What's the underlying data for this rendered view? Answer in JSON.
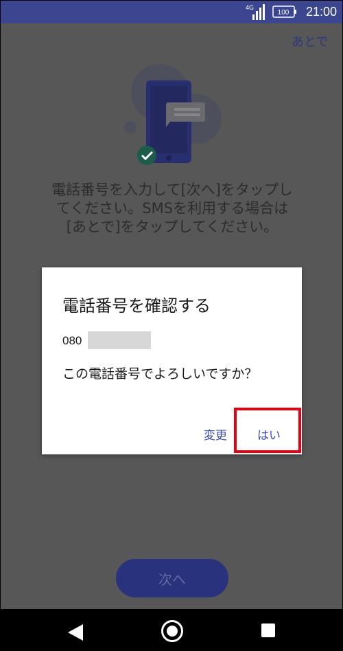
{
  "status": {
    "network": "4G",
    "battery": "100",
    "time": "21:00"
  },
  "screen": {
    "later_label": "あとで",
    "instruction": "電話番号を入力して[次へ]をタップしてください。SMSを利用する場合は[あとで]をタップしてください。",
    "next_label": "次へ"
  },
  "dialog": {
    "title": "電話番号を確認する",
    "phone_prefix": "080",
    "message": "この電話番号でよろしいですか？",
    "change_label": "変更",
    "yes_label": "はい"
  },
  "colors": {
    "accent": "#3b4590",
    "highlight": "#e60012",
    "dialog_button": "#3a49b8"
  },
  "icons": [
    "signal-icon",
    "battery-icon",
    "phone-illustration",
    "check-icon",
    "back-icon",
    "home-icon",
    "recent-apps-icon"
  ]
}
